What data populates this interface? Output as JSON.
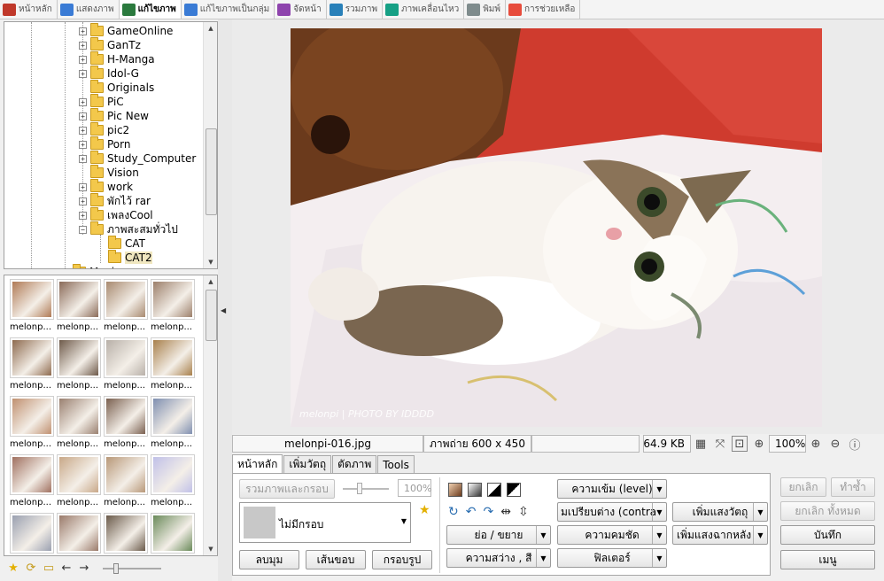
{
  "toolbar": {
    "items": [
      {
        "label": "หน้าหลัก",
        "active": false,
        "color": "#c0392b"
      },
      {
        "label": "แสดงภาพ",
        "active": false,
        "color": "#3a7bd5"
      },
      {
        "label": "แก้ไขภาพ",
        "active": true,
        "color": "#2b7a3e"
      },
      {
        "label": "แก้ไขภาพเป็นกลุ่ม",
        "active": false,
        "color": "#3a7bd5"
      },
      {
        "label": "จัดหน้า",
        "active": false,
        "color": "#8e44ad"
      },
      {
        "label": "รวมภาพ",
        "active": false,
        "color": "#2980b9"
      },
      {
        "label": "ภาพเคลื่อนไหว",
        "active": false,
        "color": "#16a085"
      },
      {
        "label": "พิมพ์",
        "active": false,
        "color": "#7f8c8d"
      },
      {
        "label": "การช่วยเหลือ",
        "active": false,
        "color": "#e74c3c"
      }
    ]
  },
  "tree": {
    "items": [
      {
        "label": "GameOnline",
        "expander": "+"
      },
      {
        "label": "GanTz",
        "expander": "+"
      },
      {
        "label": "H-Manga",
        "expander": "+"
      },
      {
        "label": "Idol-G",
        "expander": "+"
      },
      {
        "label": "Originals",
        "expander": ""
      },
      {
        "label": "PiC",
        "expander": "+"
      },
      {
        "label": "Pic New",
        "expander": "+"
      },
      {
        "label": "pic2",
        "expander": "+"
      },
      {
        "label": "Porn",
        "expander": "+"
      },
      {
        "label": "Study_Computer",
        "expander": "+"
      },
      {
        "label": "Vision",
        "expander": ""
      },
      {
        "label": "work",
        "expander": "+"
      },
      {
        "label": "พักไว้ rar",
        "expander": "+"
      },
      {
        "label": "เพลงCool",
        "expander": "+"
      },
      {
        "label": "ภาพสะสมทั่วไป",
        "expander": "−"
      },
      {
        "label": "CAT",
        "expander": ""
      },
      {
        "label": "CAT2",
        "expander": ""
      },
      {
        "label": "Movie",
        "expander": ""
      }
    ]
  },
  "thumbnails": {
    "caption": "melonp...",
    "colors": [
      "#b07a55",
      "#8a6a58",
      "#a88a70",
      "#9c7f6a",
      "#8e6a4e",
      "#6e5a4a",
      "#b8b0a8",
      "#a8804c",
      "#c09070",
      "#9a8070",
      "#7a6050",
      "#7f8fb0",
      "#a07060",
      "#c8a888",
      "#b89878",
      "#c0c0e8",
      "#9aa0b0",
      "#9a7a6a",
      "#6a5a4a",
      "#6a8a5a"
    ]
  },
  "status": {
    "filename": "melonpi-016.jpg",
    "dimensions": "ภาพถ่าย 600 x 450",
    "filesize": "64.9 KB",
    "zoom": "100%"
  },
  "photo": {
    "watermark": "melonpi | PHOTO BY IDDDD"
  },
  "panel": {
    "tabs": [
      "หน้าหลัก",
      "เพิ่มวัตถุ",
      "ตัดภาพ",
      "Tools"
    ],
    "active_tab": 0,
    "merge_frame_label": "รวมภาพและกรอบ",
    "opacity_value": "100%",
    "frame_select": "ไม่มีกรอบ",
    "frame_buttons": [
      "ลบมุม",
      "เส้นขอบ",
      "กรอบรูป"
    ],
    "adjust_buttons": [
      "ย่อ / ขยาย",
      "ความสว่าง , สี"
    ],
    "level_buttons": [
      "ความเข้ม (level)",
      "มเปรียบต่าง (contra",
      "ความคมชัด",
      "ฟิลเตอร์"
    ],
    "object_buttons": [
      "เพิ่มแสงวัตถุ",
      "เพิ่มแสงฉากหลัง"
    ]
  },
  "right_buttons": {
    "cancel": "ยกเลิก",
    "redo": "ทำซ้ำ",
    "cancel_all": "ยกเลิก ทั้งหมด",
    "save": "บันทึก",
    "menu": "เมนู"
  }
}
